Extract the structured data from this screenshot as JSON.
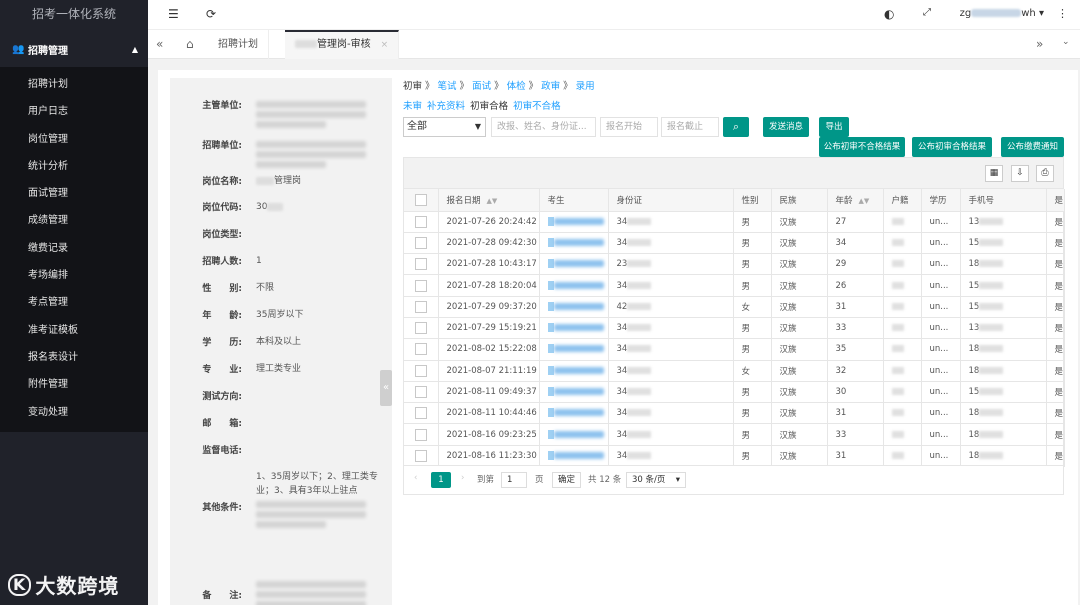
{
  "app": {
    "title": "招考一体化系统"
  },
  "sidebar": {
    "group_label": "招聘管理",
    "items": [
      {
        "label": "招聘计划"
      },
      {
        "label": "用户日志"
      },
      {
        "label": "岗位管理"
      },
      {
        "label": "统计分析"
      },
      {
        "label": "面试管理"
      },
      {
        "label": "成绩管理"
      },
      {
        "label": "缴费记录"
      },
      {
        "label": "考场编排"
      },
      {
        "label": "考点管理"
      },
      {
        "label": "准考证模板"
      },
      {
        "label": "报名表设计"
      },
      {
        "label": "附件管理"
      },
      {
        "label": "变动处理"
      }
    ]
  },
  "watermark": {
    "logo": "K",
    "text": "大数跨境"
  },
  "topbar": {
    "user_prefix": "zg",
    "user_suffix": "wh"
  },
  "tabs": [
    {
      "label": "招聘计划"
    },
    {
      "label": "管理岗-审核"
    }
  ],
  "left_panel": {
    "fields": [
      {
        "label": "主管单位:",
        "value": ""
      },
      {
        "label": "招聘单位:",
        "value": ""
      },
      {
        "label": "岗位名称:",
        "value": "管理岗"
      },
      {
        "label": "岗位代码:",
        "value": "30"
      },
      {
        "label": "岗位类型:",
        "value": ""
      },
      {
        "label": "招聘人数:",
        "value": "1"
      },
      {
        "label": "性　　别:",
        "value": "不限"
      },
      {
        "label": "年　　龄:",
        "value": "35周岁以下"
      },
      {
        "label": "学　　历:",
        "value": "本科及以上"
      },
      {
        "label": "专　　业:",
        "value": "理工类专业"
      },
      {
        "label": "测试方向:",
        "value": ""
      },
      {
        "label": "邮　　箱:",
        "value": ""
      },
      {
        "label": "监督电话:",
        "value": ""
      },
      {
        "label": "其他条件:",
        "value": "1、35周岁以下；2、理工类专业；3、具有3年以上驻点"
      },
      {
        "label": "备　　注:",
        "value": ""
      }
    ]
  },
  "steps": [
    "初审",
    "笔试",
    "面试",
    "体检",
    "政审",
    "录用"
  ],
  "substeps": {
    "a": "未审",
    "b": "补充资料",
    "c": "初审合格",
    "d": "初审不合格"
  },
  "filters": {
    "status": "全部",
    "search_placeholder": "改报、姓名、身份证...",
    "start_placeholder": "报名开始",
    "end_placeholder": "报名截止"
  },
  "buttons": {
    "send": "发送消息",
    "export": "导出",
    "pub_fail": "公布初审不合格结果",
    "pub_pass": "公布初审合格结果",
    "pub_fee": "公布缴费通知"
  },
  "table": {
    "columns": [
      "报名日期",
      "考生",
      "身份证",
      "性别",
      "民族",
      "年龄",
      "户籍",
      "学历",
      "手机号",
      "是"
    ],
    "rows": [
      {
        "date": "2021-07-26 20:24:42",
        "id": "34",
        "gender": "男",
        "ethnic": "汉族",
        "age": "27",
        "edu": "un...",
        "phone": "13",
        "yes": "是"
      },
      {
        "date": "2021-07-28 09:42:30",
        "id": "34",
        "gender": "男",
        "ethnic": "汉族",
        "age": "34",
        "edu": "un...",
        "phone": "15",
        "yes": "是"
      },
      {
        "date": "2021-07-28 10:43:17",
        "id": "23",
        "gender": "男",
        "ethnic": "汉族",
        "age": "29",
        "edu": "un...",
        "phone": "18",
        "yes": "是"
      },
      {
        "date": "2021-07-28 18:20:04",
        "id": "34",
        "gender": "男",
        "ethnic": "汉族",
        "age": "26",
        "edu": "un...",
        "phone": "15",
        "yes": "是"
      },
      {
        "date": "2021-07-29 09:37:20",
        "id": "42",
        "gender": "女",
        "ethnic": "汉族",
        "age": "31",
        "edu": "un...",
        "phone": "15",
        "yes": "是"
      },
      {
        "date": "2021-07-29 15:19:21",
        "id": "34",
        "gender": "男",
        "ethnic": "汉族",
        "age": "33",
        "edu": "un...",
        "phone": "13",
        "yes": "是"
      },
      {
        "date": "2021-08-02 15:22:08",
        "id": "34",
        "gender": "男",
        "ethnic": "汉族",
        "age": "35",
        "edu": "un...",
        "phone": "18",
        "yes": "是"
      },
      {
        "date": "2021-08-07 21:11:19",
        "id": "34",
        "gender": "女",
        "ethnic": "汉族",
        "age": "32",
        "edu": "un...",
        "phone": "18",
        "yes": "是"
      },
      {
        "date": "2021-08-11 09:49:37",
        "id": "34",
        "gender": "男",
        "ethnic": "汉族",
        "age": "30",
        "edu": "un...",
        "phone": "15",
        "yes": "是"
      },
      {
        "date": "2021-08-11 10:44:46",
        "id": "34",
        "gender": "男",
        "ethnic": "汉族",
        "age": "31",
        "edu": "un...",
        "phone": "18",
        "yes": "是"
      },
      {
        "date": "2021-08-16 09:23:25",
        "id": "34",
        "gender": "男",
        "ethnic": "汉族",
        "age": "33",
        "edu": "un...",
        "phone": "18",
        "yes": "是"
      },
      {
        "date": "2021-08-16 11:23:30",
        "id": "34",
        "gender": "男",
        "ethnic": "汉族",
        "age": "31",
        "edu": "un...",
        "phone": "18",
        "yes": "是"
      }
    ]
  },
  "pager": {
    "current": "1",
    "goto_label": "到第",
    "goto_value": "1",
    "page_unit": "页",
    "confirm": "确定",
    "total": "共 12 条",
    "per_page": "30 条/页"
  },
  "colors": {
    "accent": "#009688",
    "link": "#1e9fff",
    "sidebar": "#20222a"
  }
}
